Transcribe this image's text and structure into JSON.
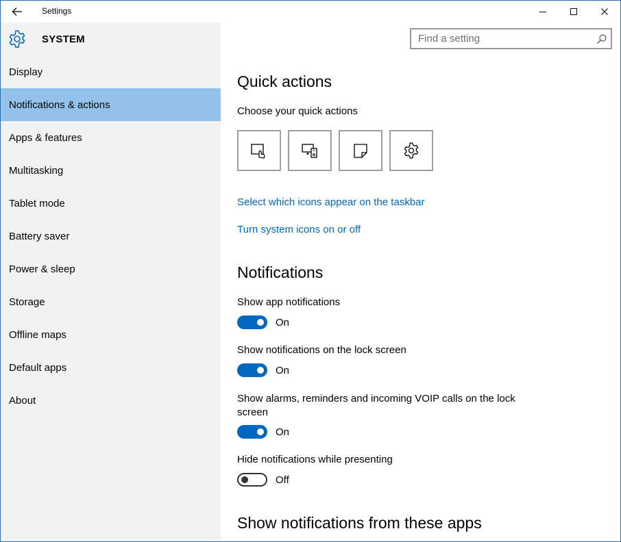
{
  "titlebar": {
    "title": "Settings"
  },
  "header": {
    "section_title": "SYSTEM",
    "search_placeholder": "Find a setting"
  },
  "sidebar": {
    "items": [
      {
        "label": "Display",
        "selected": false
      },
      {
        "label": "Notifications & actions",
        "selected": true
      },
      {
        "label": "Apps & features",
        "selected": false
      },
      {
        "label": "Multitasking",
        "selected": false
      },
      {
        "label": "Tablet mode",
        "selected": false
      },
      {
        "label": "Battery saver",
        "selected": false
      },
      {
        "label": "Power & sleep",
        "selected": false
      },
      {
        "label": "Storage",
        "selected": false
      },
      {
        "label": "Offline maps",
        "selected": false
      },
      {
        "label": "Default apps",
        "selected": false
      },
      {
        "label": "About",
        "selected": false
      }
    ]
  },
  "quick_actions": {
    "heading": "Quick actions",
    "subheading": "Choose your quick actions",
    "tiles": [
      {
        "icon": "tablet-mode-icon"
      },
      {
        "icon": "connect-project-icon"
      },
      {
        "icon": "note-icon"
      },
      {
        "icon": "settings-gear-icon"
      }
    ],
    "link_taskbar_icons": "Select which icons appear on the taskbar",
    "link_system_icons": "Turn system icons on or off"
  },
  "notifications": {
    "heading": "Notifications",
    "settings": [
      {
        "label": "Show app notifications",
        "state": "On",
        "on": true
      },
      {
        "label": "Show notifications on the lock screen",
        "state": "On",
        "on": true
      },
      {
        "label": "Show alarms, reminders and incoming VOIP calls on the lock screen",
        "state": "On",
        "on": true
      },
      {
        "label": "Hide notifications while presenting",
        "state": "Off",
        "on": false
      }
    ]
  },
  "apps_section": {
    "heading": "Show notifications from these apps"
  },
  "colors": {
    "accent": "#0067c0",
    "selected_nav": "#92c2ea",
    "sidebar_bg": "#f2f2f2"
  }
}
